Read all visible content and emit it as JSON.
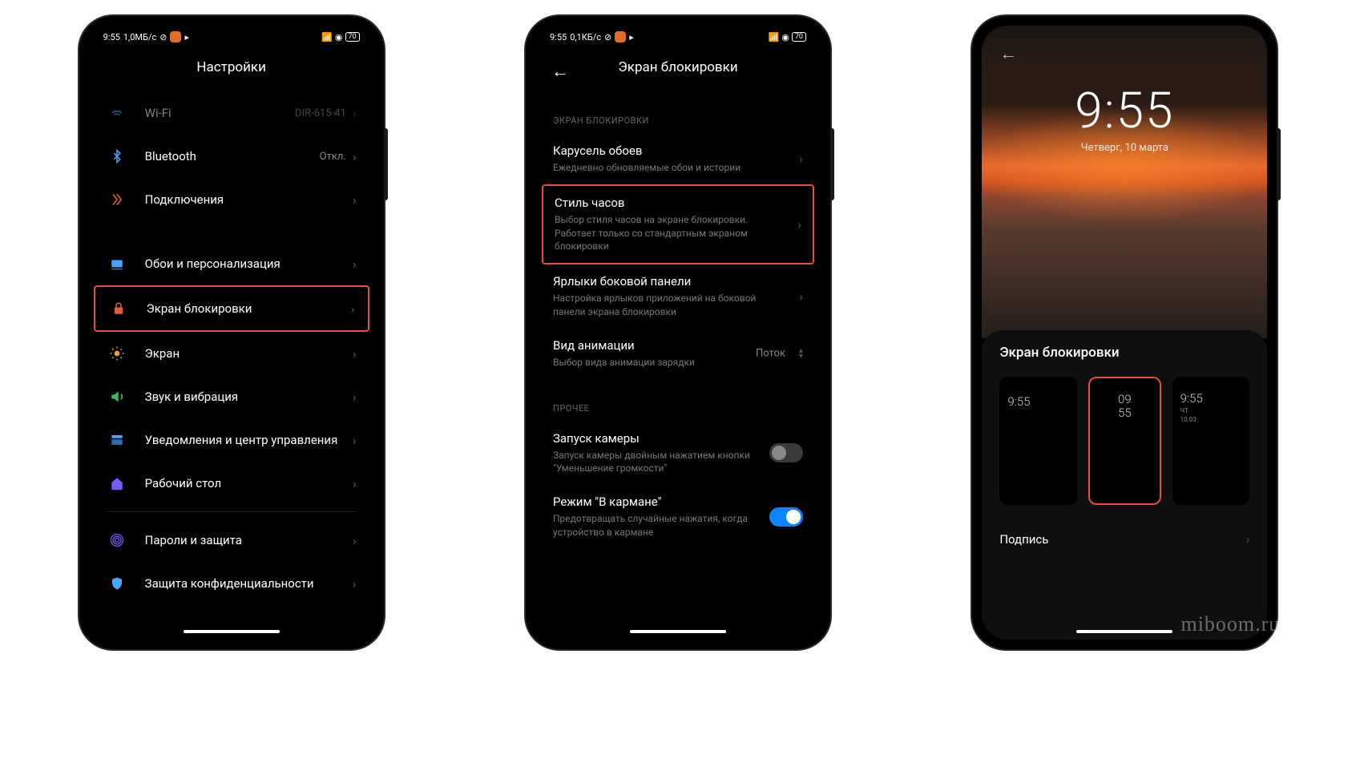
{
  "watermark": "miboom.ru",
  "statusbar": {
    "time": "9:55",
    "speed1": "1,0МБ/с",
    "speed2": "0,1КБ/с",
    "battery": "70"
  },
  "screen1": {
    "title": "Настройки",
    "items": {
      "wifi": {
        "label": "Wi-Fi",
        "value": "DIR-615-41"
      },
      "bluetooth": {
        "label": "Bluetooth",
        "value": "Откл."
      },
      "connections": {
        "label": "Подключения"
      },
      "wallpaper": {
        "label": "Обои и персонализация"
      },
      "lockscreen": {
        "label": "Экран блокировки"
      },
      "display": {
        "label": "Экран"
      },
      "sound": {
        "label": "Звук и вибрация"
      },
      "notifications": {
        "label": "Уведомления и центр управления"
      },
      "desktop": {
        "label": "Рабочий стол"
      },
      "passwords": {
        "label": "Пароли и защита"
      },
      "privacy": {
        "label": "Защита конфиденциальности"
      }
    }
  },
  "screen2": {
    "title": "Экран блокировки",
    "section1": "ЭКРАН БЛОКИРОВКИ",
    "carousel": {
      "title": "Карусель обоев",
      "sub": "Ежедневно обновляемые обои и истории"
    },
    "clockstyle": {
      "title": "Стиль часов",
      "sub": "Выбор стиля часов на экране блокировки. Работает только со стандартным экраном блокировки"
    },
    "shortcuts": {
      "title": "Ярлыки боковой панели",
      "sub": "Настройка ярлыков приложений на боковой панели экрана блокировки"
    },
    "animation": {
      "title": "Вид анимации",
      "sub": "Выбор вида анимации зарядки",
      "value": "Поток"
    },
    "section2": "ПРОЧЕЕ",
    "camera": {
      "title": "Запуск камеры",
      "sub": "Запуск камеры двойным нажатием кнопки \"Уменьшение громкости\""
    },
    "pocket": {
      "title": "Режим \"В кармане\"",
      "sub": "Предотвращать случайные нажатия, когда устройство в кармане"
    }
  },
  "screen3": {
    "time": "9:55",
    "date": "Четверг, 10 марта",
    "panel_title": "Экран блокировки",
    "thumb1": "9:55",
    "thumb2a": "09",
    "thumb2b": "55",
    "thumb3a": "9:55",
    "thumb3b": "ЧТ",
    "thumb3c": "10.03",
    "signature": "Подпись"
  }
}
